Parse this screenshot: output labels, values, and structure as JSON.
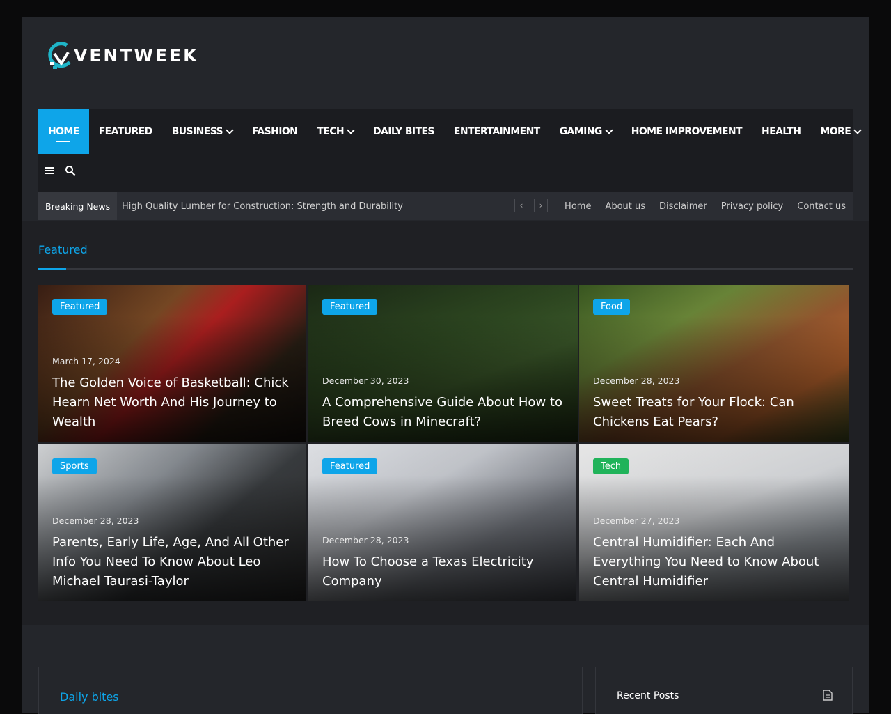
{
  "brand": {
    "logo_text": "VENTWEEK",
    "accent": "#0ea5e9"
  },
  "nav": {
    "items": [
      {
        "label": "HOME",
        "active": true,
        "dropdown": false
      },
      {
        "label": "FEATURED",
        "dropdown": false
      },
      {
        "label": "BUSINESS",
        "dropdown": true
      },
      {
        "label": "FASHION",
        "dropdown": false
      },
      {
        "label": "TECH",
        "dropdown": true
      },
      {
        "label": "DAILY BITES",
        "dropdown": false
      },
      {
        "label": "ENTERTAINMENT",
        "dropdown": false
      },
      {
        "label": "GAMING",
        "dropdown": true
      },
      {
        "label": "HOME IMPROVEMENT",
        "dropdown": false
      },
      {
        "label": "HEALTH",
        "dropdown": false
      },
      {
        "label": "MORE",
        "dropdown": true
      }
    ],
    "tools": [
      "menu-icon",
      "search-icon"
    ]
  },
  "ticker": {
    "label": "Breaking News",
    "headline": "High Quality Lumber for Construction: Strength and Durability",
    "links": [
      "Home",
      "About us",
      "Disclaimer",
      "Privacy policy",
      "Contact us"
    ]
  },
  "featured": {
    "title": "Featured",
    "cards": [
      {
        "badge": "Featured",
        "date": "March 17, 2024",
        "title": "The Golden Voice of Basketball: Chick Hearn Net Worth And His Journey to Wealth"
      },
      {
        "badge": "Featured",
        "date": "December 30, 2023",
        "title": "A Comprehensive Guide About How to Breed Cows in Minecraft?"
      },
      {
        "badge": "Food",
        "date": "December 28, 2023",
        "title": "Sweet Treats for Your Flock: Can Chickens Eat Pears?"
      },
      {
        "badge": "Sports",
        "date": "December 28, 2023",
        "title": "Parents, Early Life, Age, And All Other Info You Need To Know About Leo Michael Taurasi-Taylor"
      },
      {
        "badge": "Featured",
        "date": "December 28, 2023",
        "title": "How To Choose a Texas Electricity Company"
      },
      {
        "badge": "Tech",
        "date": "December 27, 2023",
        "title": "Central Humidifier: Each And Everything You Need to Know About Central Humidifier"
      }
    ]
  },
  "widgets": {
    "daily_bites": "Daily bites",
    "recent_posts": "Recent Posts"
  }
}
